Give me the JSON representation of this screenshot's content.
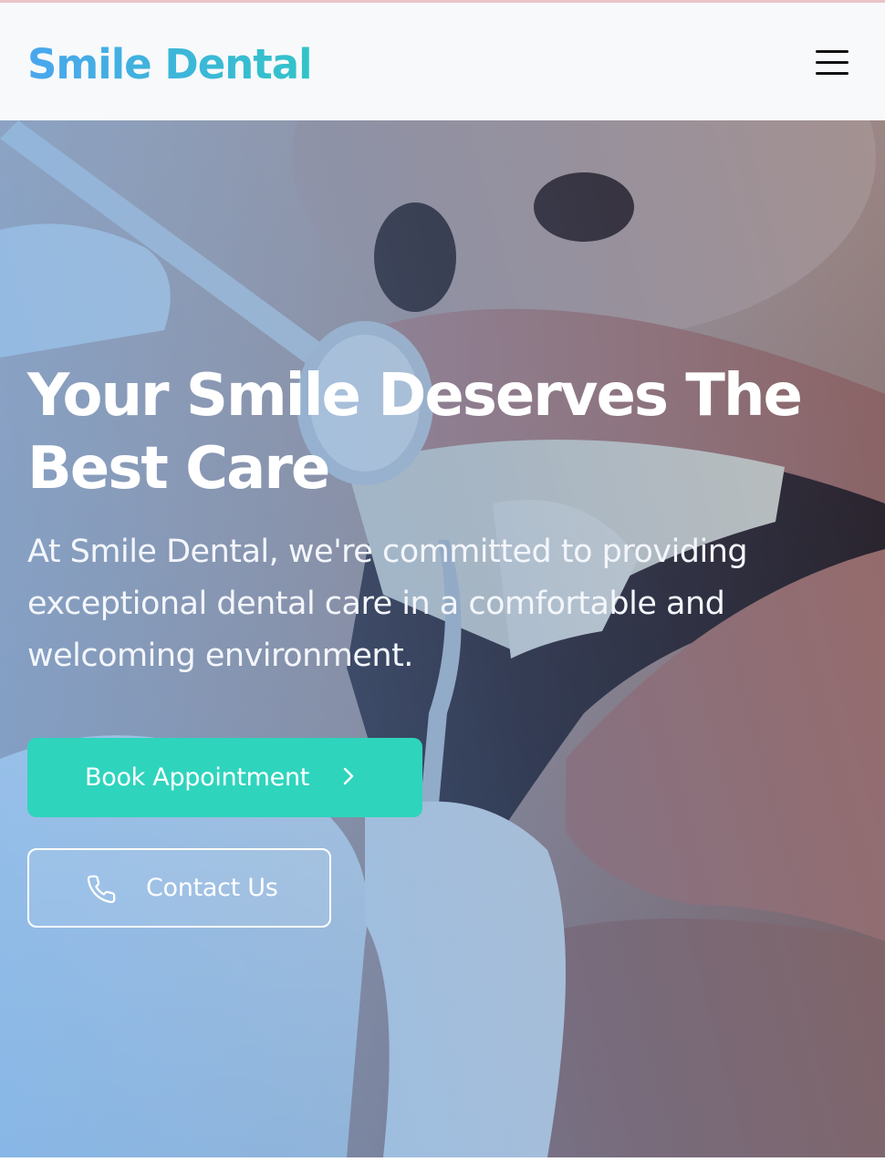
{
  "navbar": {
    "brand": "Smile Dental",
    "menu_icon": "hamburger-menu-icon",
    "brand_gradient": [
      "#4aa6ee",
      "#31c4c8"
    ]
  },
  "hero": {
    "background_image": "dental-checkup-photo",
    "title": "Your Smile Deserves The Best Care",
    "subtitle": "At Smile Dental, we're committed to providing exceptional dental care in a comfortable and welcoming environment.",
    "primary_button": {
      "label": "Book Appointment",
      "icon": "chevron-right-icon",
      "color": "#2fd4bd"
    },
    "secondary_button": {
      "label": "Contact Us",
      "icon": "phone-icon"
    }
  }
}
